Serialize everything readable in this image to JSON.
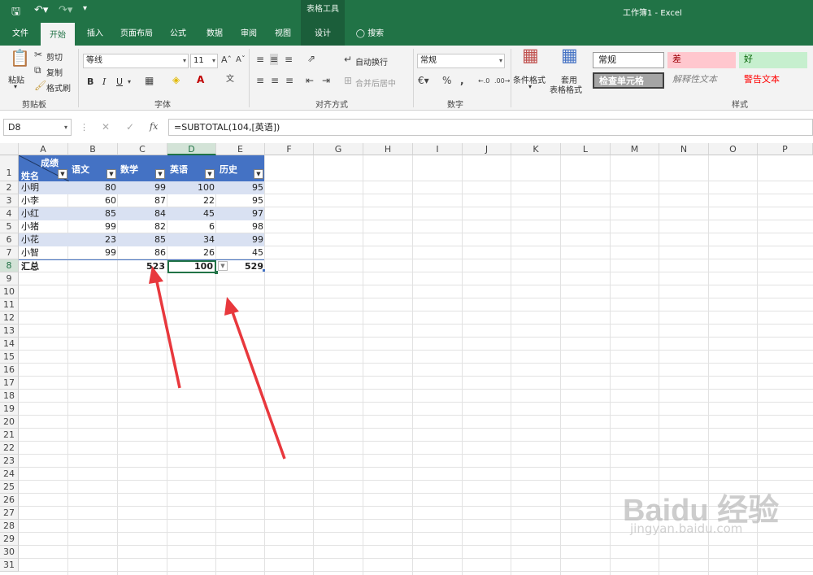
{
  "window": {
    "title": "工作簿1  -  Excel",
    "context_tool": "表格工具"
  },
  "tabs": [
    "文件",
    "开始",
    "插入",
    "页面布局",
    "公式",
    "数据",
    "审阅",
    "视图",
    "设计"
  ],
  "search": "搜索",
  "clipboard": {
    "paste": "粘贴",
    "cut": "剪切",
    "copy": "复制",
    "format_painter": "格式刷",
    "label": "剪贴板"
  },
  "font": {
    "name": "等线",
    "size": "11",
    "bold": "B",
    "italic": "I",
    "underline": "U",
    "label": "字体"
  },
  "alignment": {
    "wrap": "自动换行",
    "merge": "合并后居中",
    "label": "对齐方式"
  },
  "number": {
    "format": "常规",
    "label": "数字"
  },
  "styles": {
    "conditional": "条件格式",
    "table_format_1": "套用",
    "table_format_2": "表格格式",
    "normal": "常规",
    "bad": "差",
    "good": "好",
    "check_cell": "检查单元格",
    "explanatory": "解释性文本",
    "warning": "警告文本",
    "label": "样式"
  },
  "formula_bar": {
    "name_box": "D8",
    "formula": "=SUBTOTAL(104,[英语])"
  },
  "columns": [
    "A",
    "B",
    "C",
    "D",
    "E",
    "F",
    "G",
    "H",
    "I",
    "J",
    "K",
    "L",
    "M",
    "N",
    "O",
    "P"
  ],
  "rows": [
    "1",
    "2",
    "3",
    "4",
    "5",
    "6",
    "7",
    "8",
    "9",
    "10",
    "11",
    "12",
    "13",
    "14",
    "15",
    "16",
    "17",
    "18",
    "19",
    "20",
    "21",
    "22",
    "23",
    "24",
    "25",
    "26",
    "27",
    "28",
    "29",
    "30",
    "31"
  ],
  "table": {
    "corner_top": "成绩",
    "corner_bottom": "姓名",
    "headers": [
      "语文",
      "数学",
      "英语",
      "历史"
    ],
    "data": [
      [
        "小明",
        "80",
        "99",
        "100",
        "95"
      ],
      [
        "小李",
        "60",
        "87",
        "22",
        "95"
      ],
      [
        "小红",
        "85",
        "84",
        "45",
        "97"
      ],
      [
        "小猪",
        "99",
        "82",
        "6",
        "98"
      ],
      [
        "小花",
        "23",
        "85",
        "34",
        "99"
      ],
      [
        "小智",
        "99",
        "86",
        "26",
        "45"
      ]
    ],
    "total": [
      "汇总",
      "",
      "523",
      "100",
      "529"
    ]
  },
  "watermark": {
    "line1": "Baidu 经验",
    "line2": "jingyan.baidu.com"
  },
  "colors": {
    "excel_green": "#217346",
    "table_header": "#4472c4",
    "table_band": "#d9e1f2",
    "arrow": "#e8383d"
  }
}
